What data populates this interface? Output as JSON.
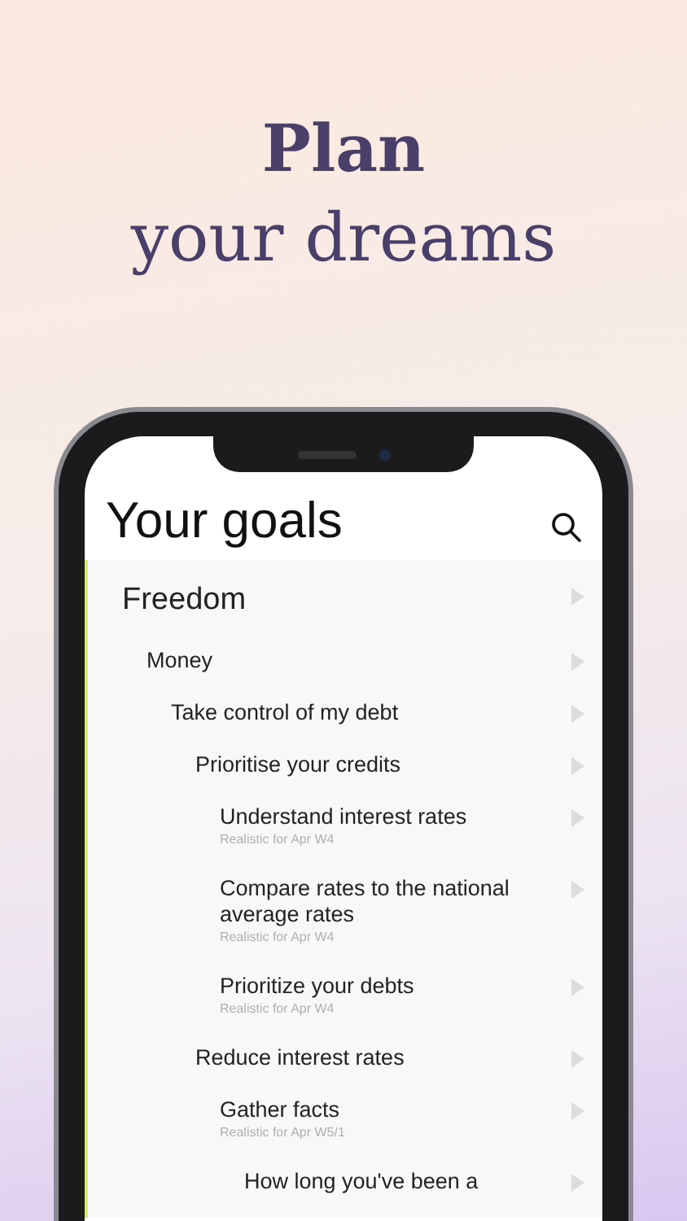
{
  "headline": {
    "title": "Plan",
    "subtitle": "your dreams"
  },
  "screen": {
    "title": "Your goals"
  },
  "goals": [
    {
      "title": "Freedom",
      "children": [
        {
          "title": "Money",
          "children": [
            {
              "title": "Take control of my debt",
              "children": [
                {
                  "title": "Prioritise your credits",
                  "children": [
                    {
                      "title": "Understand interest rates",
                      "note": "Realistic for Apr W4"
                    },
                    {
                      "title": "Compare rates to the national average rates",
                      "note": "Realistic for Apr W4"
                    },
                    {
                      "title": "Prioritize your debts",
                      "note": "Realistic for Apr W4"
                    }
                  ]
                },
                {
                  "title": "Reduce interest rates",
                  "children": [
                    {
                      "title": "Gather facts",
                      "note": "Realistic for Apr W5/1",
                      "children": [
                        {
                          "title": "How long you've been a"
                        }
                      ]
                    }
                  ]
                }
              ]
            }
          ]
        }
      ]
    }
  ]
}
